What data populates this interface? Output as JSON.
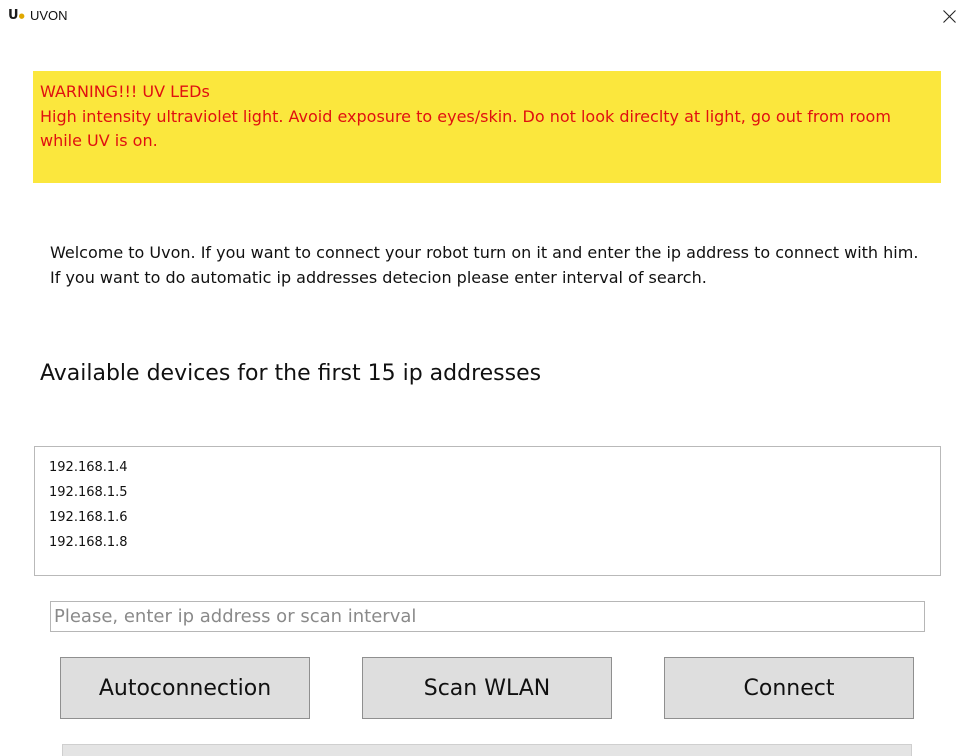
{
  "window": {
    "app_logo": "U",
    "title": "UVON",
    "close_icon": "close-icon"
  },
  "warning": {
    "line1": "WARNING!!! UV LEDs",
    "line2": "High intensity ultraviolet light. Avoid exposure to eyes/skin. Do not look direclty at light, go out from room",
    "line3": "while UV is on.",
    "background": "#fbe73d",
    "text_color": "#e01010"
  },
  "welcome_text": "Welcome to Uvon. If you want to connect your robot turn on it and enter the ip address to connect with him. If you want to do automatic ip addresses detecion please enter interval of search.",
  "devices_heading": "Available devices for the first 15 ip addresses",
  "devices": [
    "192.168.1.4",
    "192.168.1.5",
    "192.168.1.6",
    "192.168.1.8"
  ],
  "input": {
    "value": "",
    "placeholder": "Please, enter ip address or scan interval"
  },
  "buttons": {
    "autoconnection": "Autoconnection",
    "scan_wlan": "Scan WLAN",
    "connect": "Connect"
  }
}
